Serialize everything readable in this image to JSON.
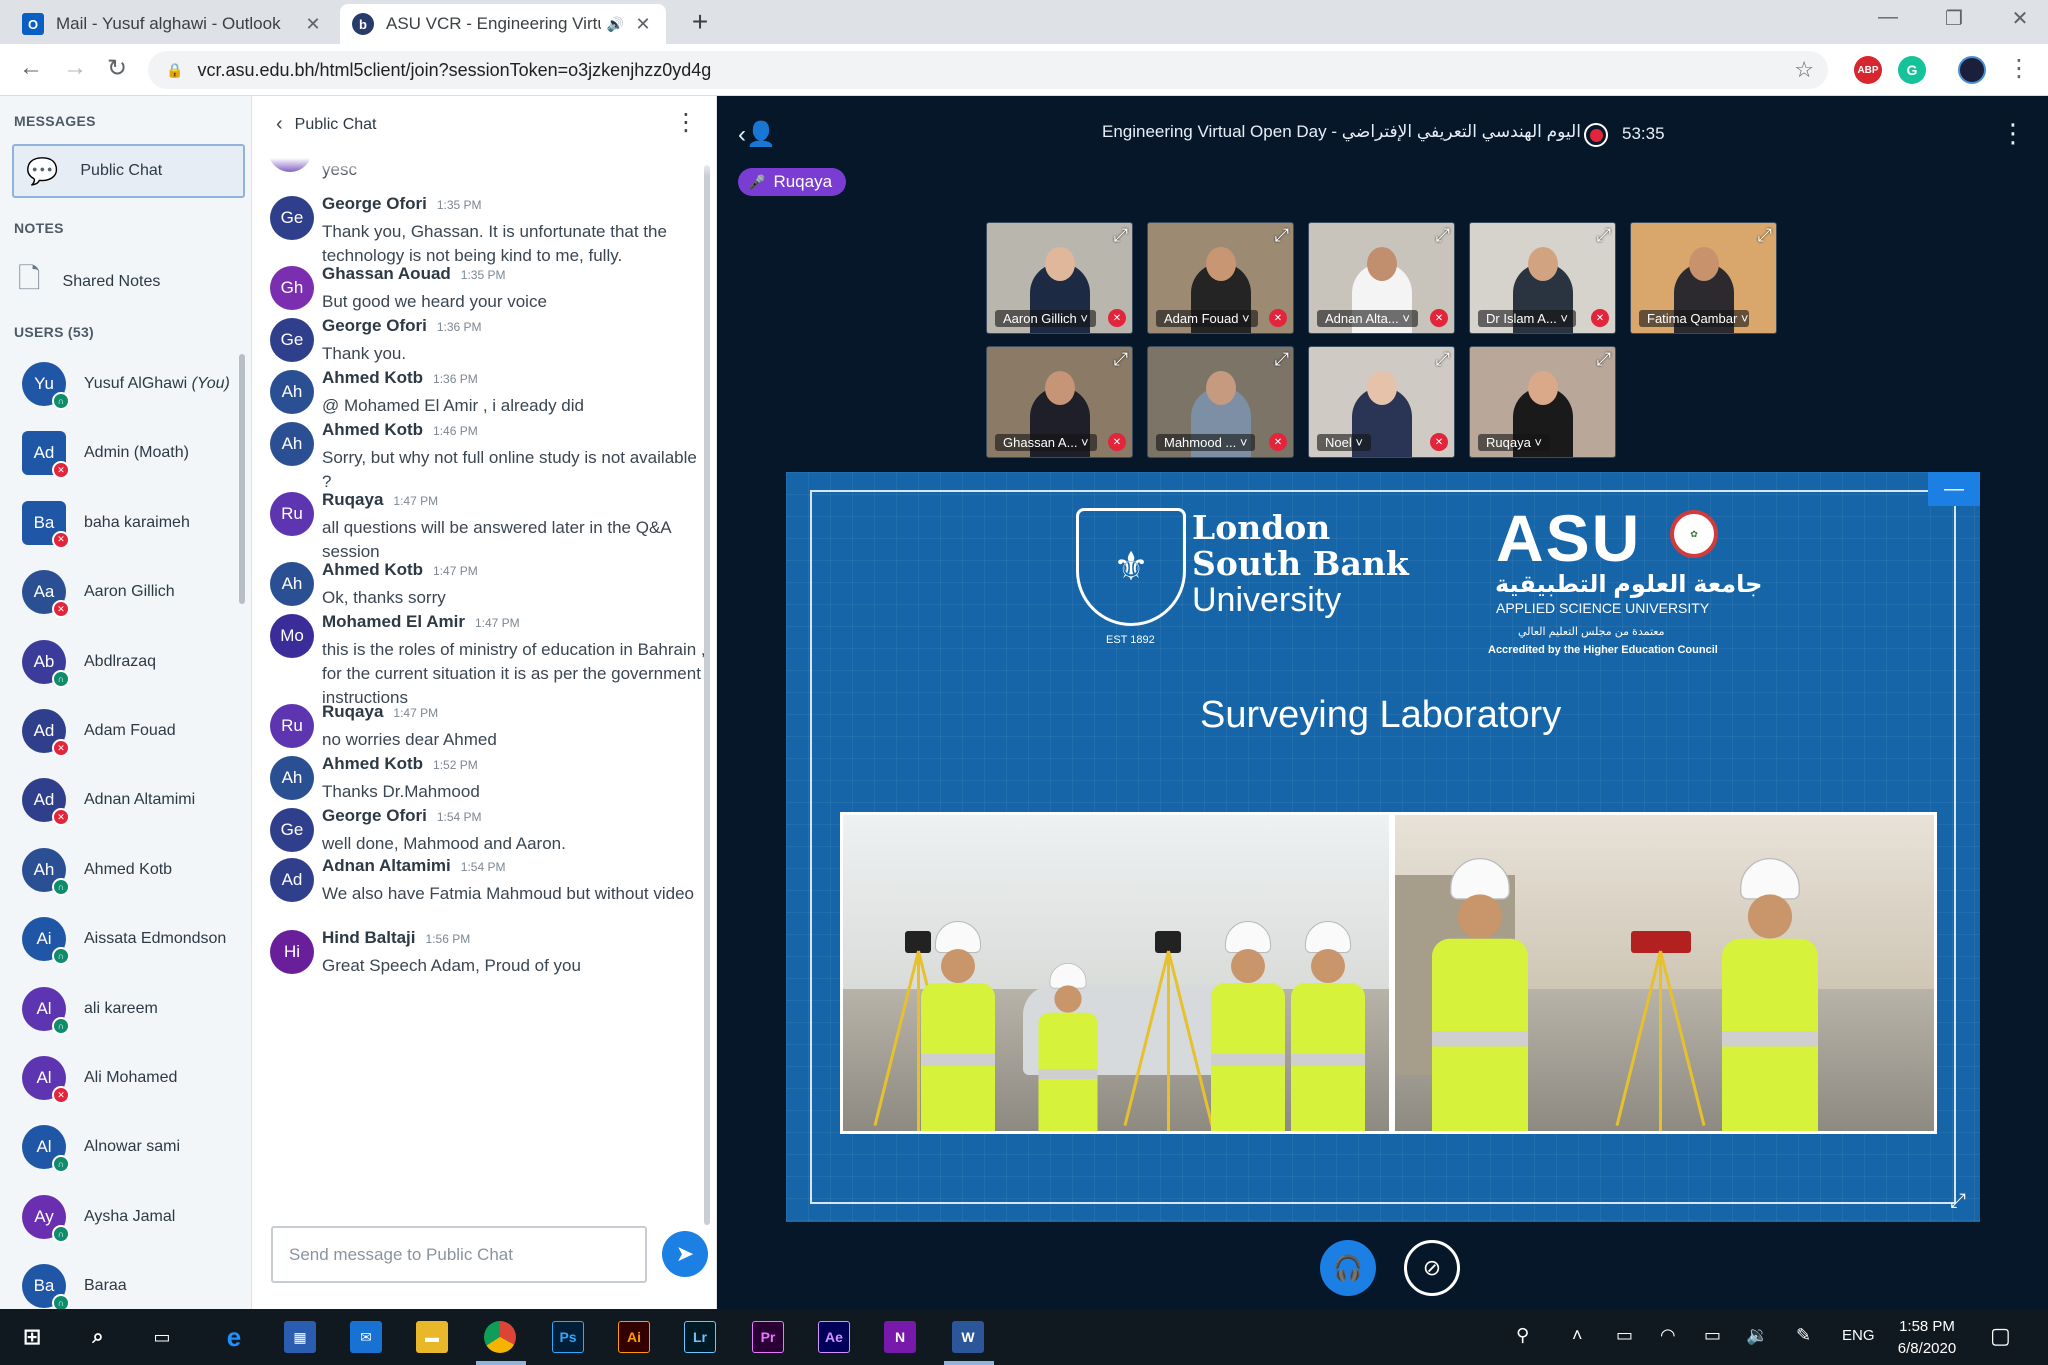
{
  "browser": {
    "tabs": [
      {
        "label": "Mail - Yusuf alghawi - Outlook",
        "icon": "outlook-icon",
        "active": false
      },
      {
        "label": "ASU VCR - Engineering Virtu",
        "icon": "bigbluebutton-icon",
        "active": true
      }
    ],
    "url": "vcr.asu.edu.bh/html5client/join?sessionToken=o3jzkenjhzz0yd4g",
    "extensions": [
      "ABP",
      "G"
    ]
  },
  "sidebar": {
    "messages_title": "MESSAGES",
    "public_chat": "Public Chat",
    "notes_title": "NOTES",
    "shared_notes": "Shared Notes",
    "users_title": "USERS (53)",
    "users": [
      {
        "initials": "Yu",
        "name": "Yusuf AlGhawi",
        "suffix": "(You)",
        "color": "#1f57a6",
        "badge": "listen"
      },
      {
        "initials": "Ad",
        "name": "Admin (Moath)",
        "color": "#1f57a6",
        "badge": "mute",
        "square": true
      },
      {
        "initials": "Ba",
        "name": "baha karaimeh",
        "color": "#1f57a6",
        "badge": "mute",
        "square": true
      },
      {
        "initials": "Aa",
        "name": "Aaron Gillich",
        "color": "#2b4f93",
        "badge": "mute"
      },
      {
        "initials": "Ab",
        "name": "Abdlrazaq",
        "color": "#3b3b9a",
        "badge": "listen"
      },
      {
        "initials": "Ad",
        "name": "Adam Fouad",
        "color": "#2f3f8c",
        "badge": "mute"
      },
      {
        "initials": "Ad",
        "name": "Adnan Altamimi",
        "color": "#2f3f8c",
        "badge": "mute"
      },
      {
        "initials": "Ah",
        "name": "Ahmed Kotb",
        "color": "#2b4f93",
        "badge": "listen"
      },
      {
        "initials": "Ai",
        "name": "Aissata Edmondson",
        "color": "#1f57a6",
        "badge": "listen"
      },
      {
        "initials": "Al",
        "name": "ali kareem",
        "color": "#5e35b1",
        "badge": "listen"
      },
      {
        "initials": "Al",
        "name": "Ali Mohamed",
        "color": "#5e35b1",
        "badge": "mute"
      },
      {
        "initials": "Al",
        "name": "Alnowar sami",
        "color": "#1f57a6",
        "badge": "listen"
      },
      {
        "initials": "Ay",
        "name": "Aysha Jamal",
        "color": "#6a2fb0",
        "badge": "listen"
      },
      {
        "initials": "Ba",
        "name": "Baraa",
        "color": "#1f57a6",
        "badge": "listen"
      }
    ]
  },
  "chat": {
    "title": "Public Chat",
    "partial_text": "yesc",
    "messages": [
      {
        "initials": "Ge",
        "name": "George Ofori",
        "time": "1:35 PM",
        "text": "Thank you, Ghassan. It is unfortunate that the technology is not being kind to me, fully.",
        "color": "#2f3f8c"
      },
      {
        "initials": "Gh",
        "name": "Ghassan Aouad",
        "time": "1:35 PM",
        "text": "But good we heard your voice",
        "color": "#7b2fb0"
      },
      {
        "initials": "Ge",
        "name": "George Ofori",
        "time": "1:36 PM",
        "text": "Thank you.",
        "color": "#2f3f8c"
      },
      {
        "initials": "Ah",
        "name": "Ahmed Kotb",
        "time": "1:36 PM",
        "text": "@ Mohamed El Amir , i already did",
        "color": "#2b4f93"
      },
      {
        "initials": "Ah",
        "name": "Ahmed Kotb",
        "time": "1:46 PM",
        "text": "Sorry, but why not full online study is not available ?",
        "color": "#2b4f93"
      },
      {
        "initials": "Ru",
        "name": "Ruqaya",
        "time": "1:47 PM",
        "text": "all questions will be answered later in the Q&A session",
        "color": "#5e35b1"
      },
      {
        "initials": "Ah",
        "name": "Ahmed Kotb",
        "time": "1:47 PM",
        "text": "Ok, thanks sorry",
        "color": "#2b4f93"
      },
      {
        "initials": "Mo",
        "name": "Mohamed El Amir",
        "time": "1:47 PM",
        "text": "this is the roles of ministry of education in Bahrain , for the current situation it is as per the government instructions",
        "color": "#3a2d9a"
      },
      {
        "initials": "Ru",
        "name": "Ruqaya",
        "time": "1:47 PM",
        "text": "no worries dear Ahmed",
        "color": "#5e35b1"
      },
      {
        "initials": "Ah",
        "name": "Ahmed Kotb",
        "time": "1:52 PM",
        "text": "Thanks Dr.Mahmood",
        "color": "#2b4f93"
      },
      {
        "initials": "Ge",
        "name": "George Ofori",
        "time": "1:54 PM",
        "text": "well done, Mahmood and Aaron.",
        "color": "#2f3f8c"
      },
      {
        "initials": "Ad",
        "name": "Adnan Altamimi",
        "time": "1:54 PM",
        "text": "We also have Fatmia Mahmoud but without video",
        "color": "#2f3f8c"
      },
      {
        "initials": "Hi",
        "name": "Hind Baltaji",
        "time": "1:56 PM",
        "text": "Great Speech Adam, Proud of you",
        "color": "#6a1f9a"
      }
    ],
    "input_placeholder": "Send message to Public Chat"
  },
  "main": {
    "title": "Engineering Virtual Open Day - اليوم الهندسي التعريفي الإفتراضي",
    "recording_time": "53:35",
    "talking": "Ruqaya",
    "video_tiles": [
      {
        "label": "Aaron Gillich",
        "muted": true,
        "bg": "#b9b6ae",
        "shirt": "#1d2a44",
        "skin": "#e0b79a"
      },
      {
        "label": "Adam Fouad",
        "muted": true,
        "bg": "#9c8a73",
        "shirt": "#242424",
        "skin": "#c99673"
      },
      {
        "label": "Adnan Alta...",
        "muted": true,
        "bg": "#c9c4bb",
        "shirt": "#f4f4f4",
        "skin": "#c18e6e"
      },
      {
        "label": "Dr Islam A...",
        "muted": true,
        "bg": "#d6d3cc",
        "shirt": "#2a3340",
        "skin": "#d2a381"
      },
      {
        "label": "Fatima Qambar",
        "muted": false,
        "bg": "#d9a76b",
        "shirt": "#2c2a2e",
        "skin": "#c8926d"
      },
      {
        "label": "Ghassan A...",
        "muted": true,
        "bg": "#8a7a66",
        "shirt": "#1f1f2a",
        "skin": "#c69476"
      },
      {
        "label": "Mahmood ...",
        "muted": true,
        "bg": "#7c7466",
        "shirt": "#7c8fa4",
        "skin": "#c59a7f"
      },
      {
        "label": "Noel",
        "muted": true,
        "bg": "#cfcac4",
        "shirt": "#2a3556",
        "skin": "#e6c2aa"
      },
      {
        "label": "Ruqaya",
        "muted": false,
        "bg": "#b9a79a",
        "shirt": "#1a1a1a",
        "skin": "#d9a98a"
      }
    ],
    "slide": {
      "lsbu_line1": "London",
      "lsbu_line2": "South Bank",
      "lsbu_line3": "University",
      "lsbu_est": "EST 1892",
      "asu_logo": "ASU",
      "asu_arabic": "جامعة العلوم التطبيقية",
      "asu_english": "APPLIED SCIENCE UNIVERSITY",
      "asu_accredited_ar": "معتمدة من مجلس التعليم العالي",
      "asu_accredited": "Accredited by the Higher Education Council",
      "title": "Surveying Laboratory"
    }
  },
  "taskbar": {
    "apps": [
      "Ps",
      "Ai",
      "Lr",
      "Pr",
      "Ae",
      "N",
      "W"
    ],
    "language": "ENG",
    "time": "1:58 PM",
    "date": "6/8/2020"
  }
}
